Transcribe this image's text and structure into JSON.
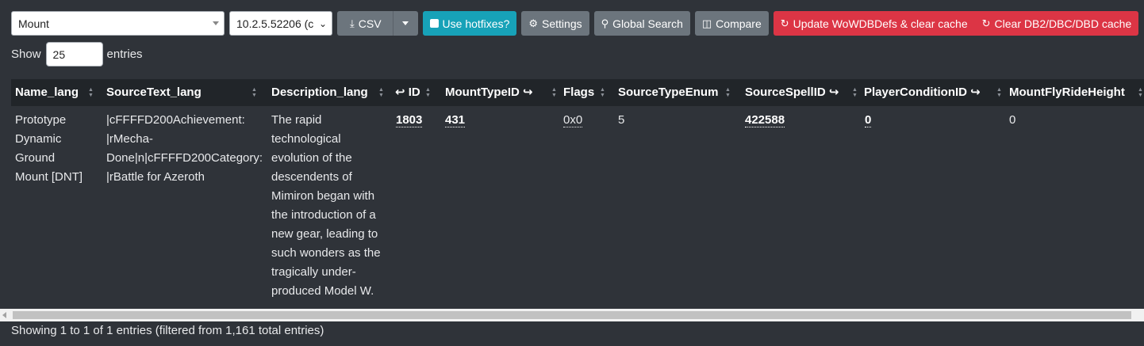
{
  "toolbar": {
    "table_select": "Mount",
    "build_select": "10.2.5.52206 (c",
    "csv_label": "CSV",
    "hotfix_label": "Use hotfixes?",
    "settings_label": "Settings",
    "global_search_label": "Global Search",
    "compare_label": "Compare",
    "update_label": "Update WoWDBDefs & clear cache",
    "clear_label": "Clear DB2/DBC/DBD cache",
    "colors": {
      "grey": "#6c757d",
      "teal": "#17a2b8",
      "red": "#dc3545"
    }
  },
  "length": {
    "show": "Show",
    "value": "25",
    "entries": "entries"
  },
  "table": {
    "headers": [
      "Name_lang",
      "SourceText_lang",
      "Description_lang",
      "ID",
      "MountTypeID",
      "Flags",
      "SourceTypeEnum",
      "SourceSpellID",
      "PlayerConditionID",
      "MountFlyRideHeight"
    ],
    "row": {
      "name": [
        "Prototype",
        "Dynamic",
        "Ground",
        "Mount [DNT]"
      ],
      "source_text": [
        "|cFFFFD200Achievement:",
        "|rMecha-",
        "Done|n|cFFFFD200Category:",
        "|rBattle for Azeroth"
      ],
      "description": [
        "The rapid",
        "technological",
        "evolution of the",
        "descendents of",
        "Mimiron began with",
        "the introduction of a",
        "new gear, leading to",
        "such wonders as the",
        "tragically under-",
        "produced Model W."
      ],
      "id": "1803",
      "mount_type_id": "431",
      "flags": "0x0",
      "source_type_enum": "5",
      "source_spell_id": "422588",
      "player_condition_id": "0",
      "mount_fly_ride_height": "0"
    }
  },
  "footer": {
    "info": "Showing 1 to 1 of 1 entries (filtered from 1,161 total entries)"
  }
}
